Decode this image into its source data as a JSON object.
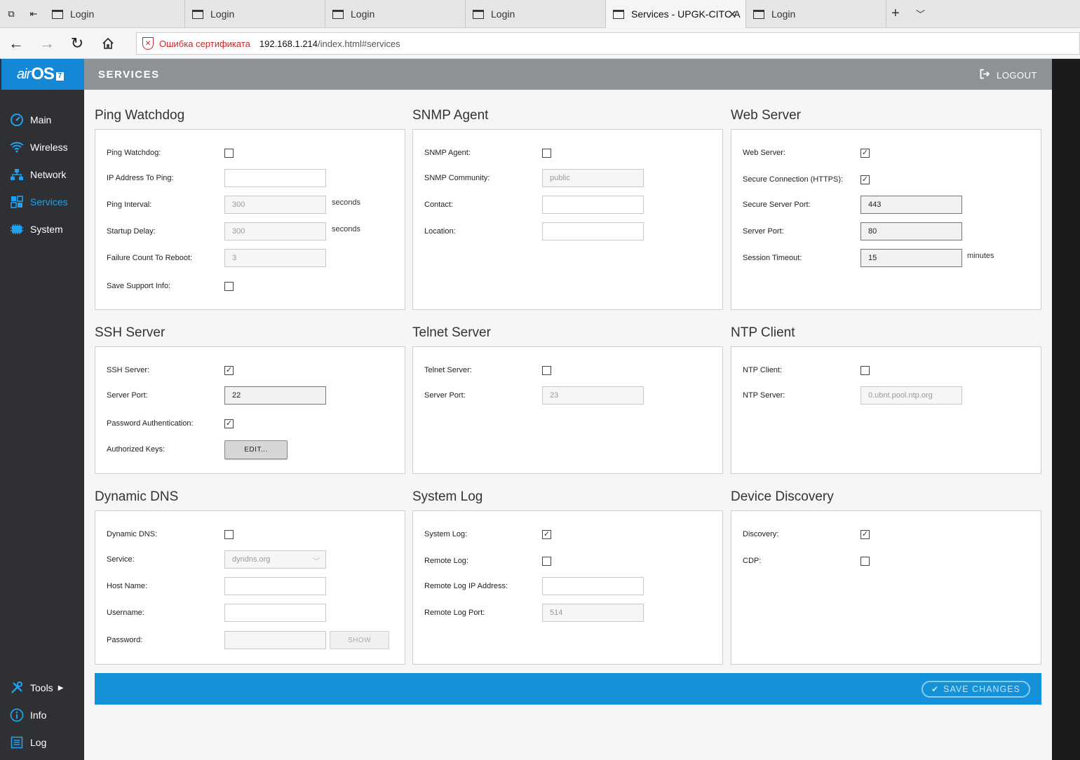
{
  "browser": {
    "tabs": [
      {
        "title": "Login",
        "active": false
      },
      {
        "title": "Login",
        "active": false
      },
      {
        "title": "Login",
        "active": false
      },
      {
        "title": "Login",
        "active": false
      },
      {
        "title": "Services - UPGK-CITC A",
        "active": true
      },
      {
        "title": "Login",
        "active": false
      }
    ],
    "cert_error": "Ошибка сертификата",
    "url_host": "192.168.1.214",
    "url_path": "/index.html#services"
  },
  "logo": {
    "air": "air",
    "os": "OS",
    "version": "7"
  },
  "sidebar": {
    "items": [
      {
        "label": "Main",
        "icon": "dashboard-icon"
      },
      {
        "label": "Wireless",
        "icon": "wifi-icon"
      },
      {
        "label": "Network",
        "icon": "network-icon"
      },
      {
        "label": "Services",
        "icon": "services-icon",
        "active": true
      },
      {
        "label": "System",
        "icon": "system-icon"
      }
    ],
    "bottom": [
      {
        "label": "Tools",
        "icon": "tools-icon"
      },
      {
        "label": "Info",
        "icon": "info-icon"
      },
      {
        "label": "Log",
        "icon": "log-icon"
      }
    ]
  },
  "header": {
    "title": "SERVICES",
    "logout": "LOGOUT"
  },
  "sections": {
    "ping_watchdog": {
      "title": "Ping Watchdog",
      "enabled_label": "Ping Watchdog:",
      "enabled": false,
      "ip_label": "IP Address To Ping:",
      "ip_value": "",
      "interval_label": "Ping Interval:",
      "interval_value": "300",
      "interval_unit": "seconds",
      "startup_label": "Startup Delay:",
      "startup_value": "300",
      "startup_unit": "seconds",
      "failure_label": "Failure Count To Reboot:",
      "failure_value": "3",
      "support_label": "Save Support Info:",
      "support": false
    },
    "snmp": {
      "title": "SNMP Agent",
      "enabled_label": "SNMP Agent:",
      "enabled": false,
      "community_label": "SNMP Community:",
      "community_value": "public",
      "contact_label": "Contact:",
      "contact_value": "",
      "location_label": "Location:",
      "location_value": ""
    },
    "web": {
      "title": "Web Server",
      "enabled_label": "Web Server:",
      "enabled": true,
      "https_label": "Secure Connection (HTTPS):",
      "https": true,
      "secure_port_label": "Secure Server Port:",
      "secure_port_value": "443",
      "port_label": "Server Port:",
      "port_value": "80",
      "timeout_label": "Session Timeout:",
      "timeout_value": "15",
      "timeout_unit": "minutes"
    },
    "ssh": {
      "title": "SSH Server",
      "enabled_label": "SSH Server:",
      "enabled": true,
      "port_label": "Server Port:",
      "port_value": "22",
      "password_label": "Password Authentication:",
      "password": true,
      "keys_label": "Authorized Keys:",
      "keys_button": "EDIT..."
    },
    "telnet": {
      "title": "Telnet Server",
      "enabled_label": "Telnet Server:",
      "enabled": false,
      "port_label": "Server Port:",
      "port_value": "23"
    },
    "ntp": {
      "title": "NTP Client",
      "enabled_label": "NTP Client:",
      "enabled": false,
      "server_label": "NTP Server:",
      "server_value": "0.ubnt.pool.ntp.org"
    },
    "ddns": {
      "title": "Dynamic DNS",
      "enabled_label": "Dynamic DNS:",
      "enabled": false,
      "service_label": "Service:",
      "service_value": "dyndns.org",
      "host_label": "Host Name:",
      "host_value": "",
      "user_label": "Username:",
      "user_value": "",
      "pass_label": "Password:",
      "pass_value": "",
      "show_button": "SHOW"
    },
    "syslog": {
      "title": "System Log",
      "enabled_label": "System Log:",
      "enabled": true,
      "remote_label": "Remote Log:",
      "remote": false,
      "remote_ip_label": "Remote Log IP Address:",
      "remote_ip_value": "",
      "remote_port_label": "Remote Log Port:",
      "remote_port_value": "514"
    },
    "discovery": {
      "title": "Device Discovery",
      "enabled_label": "Discovery:",
      "enabled": true,
      "cdp_label": "CDP:",
      "cdp": false
    }
  },
  "save_button": "SAVE CHANGES",
  "colors": {
    "accent": "#1391d9",
    "sidebar": "#2f3033",
    "header": "#8d9297",
    "active_item": "#1ea2f0"
  }
}
